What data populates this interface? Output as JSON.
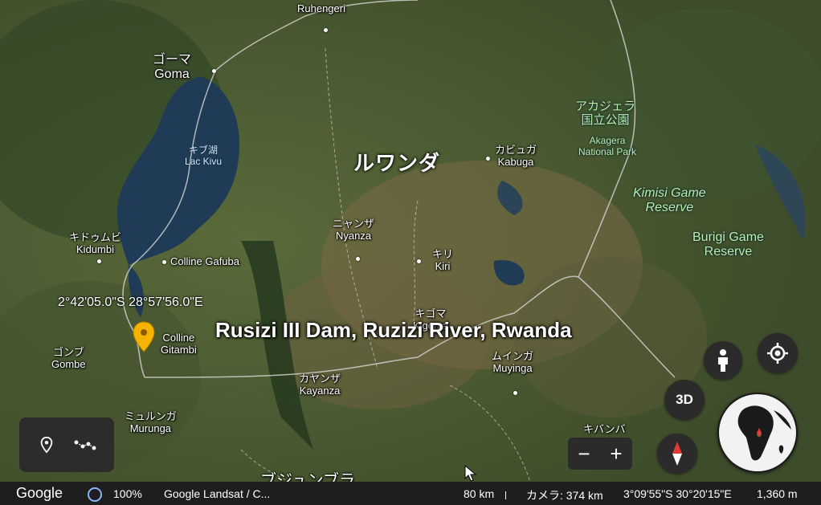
{
  "map": {
    "country": "ルワンダ",
    "places": [
      {
        "id": "ruhengeri",
        "en": "Ruhengeri"
      },
      {
        "id": "goma",
        "ja": "ゴーマ",
        "en": "Goma"
      },
      {
        "id": "lac-kivu",
        "ja": "キブ湖",
        "en": "Lac Kivu"
      },
      {
        "id": "kidumbi",
        "ja": "キドゥムビ",
        "en": "Kidumbi"
      },
      {
        "id": "colline-gafuba",
        "en": "Colline Gafuba"
      },
      {
        "id": "colline-gitambi",
        "en1": "Colline",
        "en2": "Gitambi"
      },
      {
        "id": "gombe",
        "ja": "ゴンブ",
        "en": "Gombe"
      },
      {
        "id": "murunga",
        "ja": "ミュルンガ",
        "en": "Murunga"
      },
      {
        "id": "nyanza",
        "ja": "ニャンザ",
        "en": "Nyanza"
      },
      {
        "id": "kiri",
        "ja": "キリ",
        "en": "Kiri"
      },
      {
        "id": "kigoma",
        "ja": "キゴマ",
        "en": "Kigoma"
      },
      {
        "id": "kayanza",
        "ja": "カヤンザ",
        "en": "Kayanza"
      },
      {
        "id": "muyinga",
        "ja": "ムインガ",
        "en": "Muyinga"
      },
      {
        "id": "kabuga",
        "ja": "カビュガ",
        "en": "Kabuga"
      },
      {
        "id": "akagera",
        "ja1": "アカジェラ",
        "ja2": "国立公園",
        "en1": "Akagera",
        "en2": "National Park"
      },
      {
        "id": "kimisi",
        "en1": "Kimisi Game",
        "en2": "Reserve"
      },
      {
        "id": "burigi",
        "en1": "Burigi Game",
        "en2": "Reserve"
      },
      {
        "id": "kibamba",
        "ja": "キバンバ"
      },
      {
        "id": "bujumbura",
        "ja": "ブジュンブラ"
      }
    ],
    "placemark_title": "Rusizi III Dam, Ruzizi River, Rwanda",
    "placemark_coords": "2°42'05.0\"S 28°57'56.0\"E"
  },
  "controls": {
    "button_3d": "3D",
    "zoom_out": "−",
    "zoom_in": "+"
  },
  "status_bar": {
    "logo": "Google",
    "loading_percent": "100%",
    "attribution": "Google  Landsat / C...",
    "scale": "80 km",
    "camera": "カメラ: 374 km",
    "coordinates": "3°09'55\"S 30°20'15\"E",
    "elevation": "1,360 m"
  },
  "colors": {
    "pin": "#f4b400",
    "panel": "#2b2b2b",
    "park_text": "#b8f0a8",
    "lake": "#1f3b55"
  },
  "icons": [
    "placemark-icon",
    "path-icon",
    "pegman-icon",
    "my-location-icon",
    "compass-icon",
    "globe-icon",
    "loading-ring-icon",
    "cursor-icon"
  ]
}
